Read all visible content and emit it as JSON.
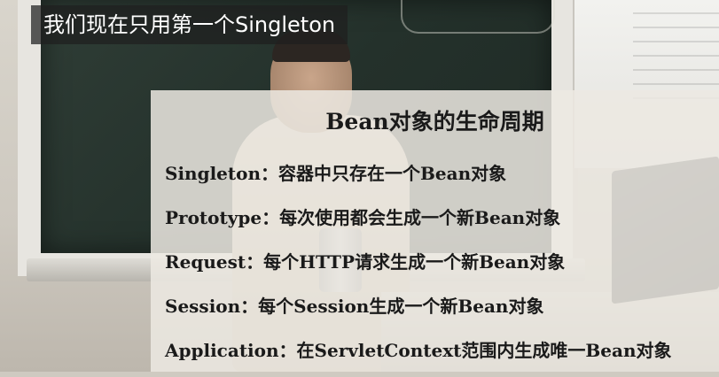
{
  "caption": {
    "text": "我们现在只用第一个Singleton"
  },
  "slide": {
    "title": "Bean对象的生命周期",
    "items": [
      {
        "term": "Singleton",
        "sep": "：",
        "desc": "容器中只存在一个Bean对象"
      },
      {
        "term": "Prototype",
        "sep": "：",
        "desc": "每次使用都会生成一个新Bean对象"
      },
      {
        "term": "Request",
        "sep": "：",
        "desc": "每个HTTP请求生成一个新Bean对象"
      },
      {
        "term": "Session",
        "sep": "：",
        "desc": "每个Session生成一个新Bean对象"
      },
      {
        "term": "Application",
        "sep": "：",
        "desc": "在ServletContext范围内生成唯一Bean对象"
      }
    ]
  }
}
